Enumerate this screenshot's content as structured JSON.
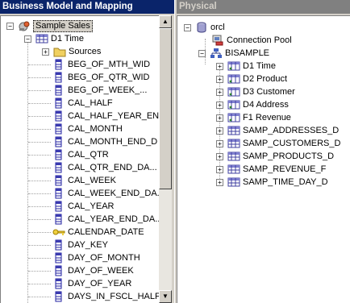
{
  "business_model": {
    "title": "Business Model and Mapping",
    "root": {
      "label": "Sample Sales",
      "icon": "business-model-icon",
      "expanded": true,
      "selected": true
    },
    "table": {
      "label": "D1 Time",
      "icon": "logical-table-icon",
      "expanded": true
    },
    "sources": {
      "label": "Sources",
      "icon": "folder-icon",
      "expanded": false
    },
    "columns": [
      {
        "label": "BEG_OF_MTH_WID",
        "icon": "column-icon"
      },
      {
        "label": "BEG_OF_QTR_WID",
        "icon": "column-icon"
      },
      {
        "label": "BEG_OF_WEEK_...",
        "icon": "column-icon"
      },
      {
        "label": "CAL_HALF",
        "icon": "column-icon"
      },
      {
        "label": "CAL_HALF_YEAR_EN",
        "icon": "column-icon"
      },
      {
        "label": "CAL_MONTH",
        "icon": "column-icon"
      },
      {
        "label": "CAL_MONTH_END_D",
        "icon": "column-icon"
      },
      {
        "label": "CAL_QTR",
        "icon": "column-icon"
      },
      {
        "label": "CAL_QTR_END_DA...",
        "icon": "column-icon"
      },
      {
        "label": "CAL_WEEK",
        "icon": "column-icon"
      },
      {
        "label": "CAL_WEEK_END_DA...",
        "icon": "column-icon"
      },
      {
        "label": "CAL_YEAR",
        "icon": "column-icon"
      },
      {
        "label": "CAL_YEAR_END_DA...",
        "icon": "column-icon"
      },
      {
        "label": "CALENDAR_DATE",
        "icon": "key-icon"
      },
      {
        "label": "DAY_KEY",
        "icon": "column-icon"
      },
      {
        "label": "DAY_OF_MONTH",
        "icon": "column-icon"
      },
      {
        "label": "DAY_OF_WEEK",
        "icon": "column-icon"
      },
      {
        "label": "DAY_OF_YEAR",
        "icon": "column-icon"
      },
      {
        "label": "DAYS_IN_FSCL_HALF",
        "icon": "column-icon"
      }
    ]
  },
  "physical": {
    "title": "Physical",
    "database": {
      "label": "orcl",
      "icon": "database-icon",
      "expanded": true
    },
    "connection_pool": {
      "label": "Connection Pool",
      "icon": "connection-pool-icon"
    },
    "schema": {
      "label": "BISAMPLE",
      "icon": "schema-icon",
      "expanded": true
    },
    "tables": [
      {
        "label": "D1 Time",
        "icon": "alias-table-icon"
      },
      {
        "label": "D2 Product",
        "icon": "alias-table-icon"
      },
      {
        "label": "D3 Customer",
        "icon": "alias-table-icon"
      },
      {
        "label": "D4 Address",
        "icon": "alias-table-icon"
      },
      {
        "label": "F1 Revenue",
        "icon": "alias-table-icon"
      },
      {
        "label": "SAMP_ADDRESSES_D",
        "icon": "physical-table-icon"
      },
      {
        "label": "SAMP_CUSTOMERS_D",
        "icon": "physical-table-icon"
      },
      {
        "label": "SAMP_PRODUCTS_D",
        "icon": "physical-table-icon"
      },
      {
        "label": "SAMP_REVENUE_F",
        "icon": "physical-table-icon"
      },
      {
        "label": "SAMP_TIME_DAY_D",
        "icon": "physical-table-icon"
      }
    ]
  },
  "colors": {
    "active_title": "#0a246a",
    "inactive_title": "#808080",
    "column_icon": "#3a3ab0",
    "key_icon": "#d8b000"
  }
}
